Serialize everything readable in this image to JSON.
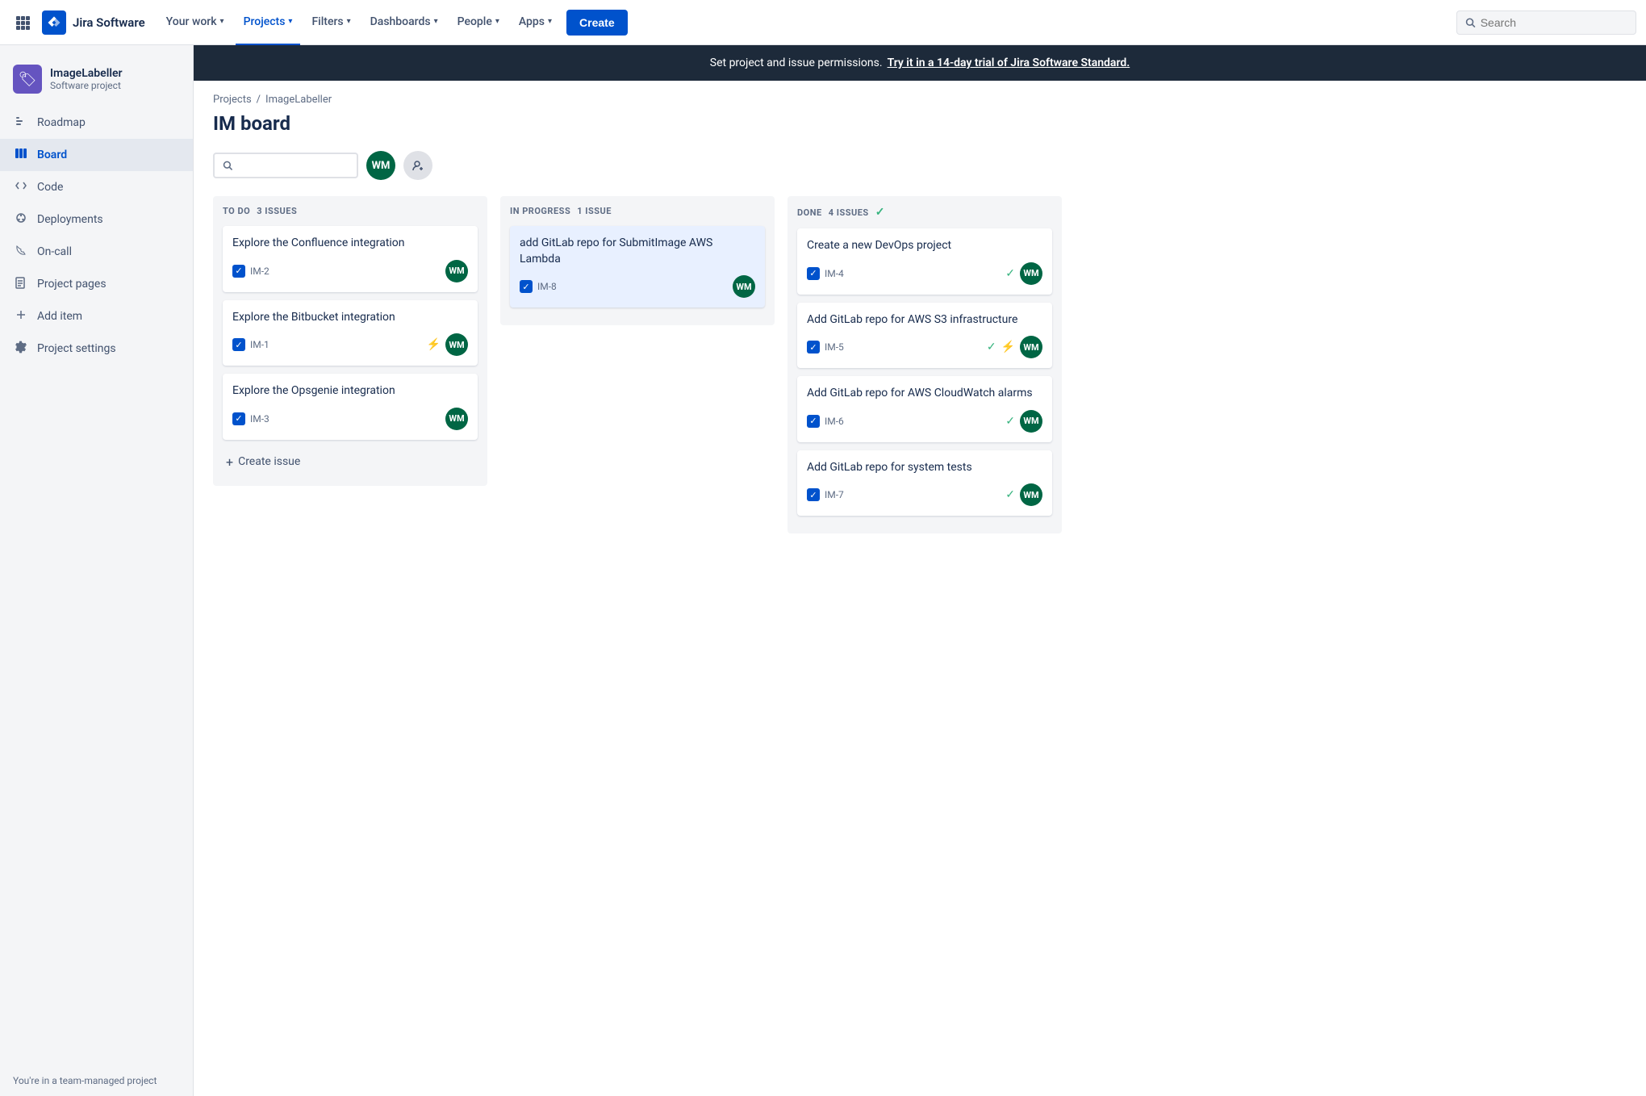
{
  "topnav": {
    "logo_text": "Jira Software",
    "nav_items": [
      {
        "label": "Your work",
        "has_chevron": true,
        "active": false
      },
      {
        "label": "Projects",
        "has_chevron": true,
        "active": true
      },
      {
        "label": "Filters",
        "has_chevron": true,
        "active": false
      },
      {
        "label": "Dashboards",
        "has_chevron": true,
        "active": false
      },
      {
        "label": "People",
        "has_chevron": true,
        "active": false
      },
      {
        "label": "Apps",
        "has_chevron": true,
        "active": false
      }
    ],
    "create_label": "Create",
    "search_placeholder": "Search"
  },
  "banner": {
    "text": "Set project and issue permissions.",
    "link_text": "Try it in a 14-day trial of Jira Software Standard."
  },
  "sidebar": {
    "project_name": "ImageLabeller",
    "project_type": "Software project",
    "nav_items": [
      {
        "label": "Roadmap",
        "icon": "roadmap"
      },
      {
        "label": "Board",
        "icon": "board",
        "active": true
      },
      {
        "label": "Code",
        "icon": "code"
      },
      {
        "label": "Deployments",
        "icon": "deployments"
      },
      {
        "label": "On-call",
        "icon": "oncall"
      },
      {
        "label": "Project pages",
        "icon": "pages"
      },
      {
        "label": "Add item",
        "icon": "add"
      },
      {
        "label": "Project settings",
        "icon": "settings"
      }
    ],
    "footer_text": "You're in a team-managed project"
  },
  "breadcrumb": {
    "parent": "Projects",
    "current": "ImageLabeller"
  },
  "page_title": "IM board",
  "avatar": {
    "initials": "WM",
    "color": "#006644"
  },
  "board": {
    "columns": [
      {
        "id": "todo",
        "label": "TO DO",
        "issue_count": "3 ISSUES",
        "cards": [
          {
            "id": "card-im2",
            "title": "Explore the Confluence integration",
            "issue_id": "IM-2",
            "highlighted": false,
            "show_done_check": false,
            "show_story_icon": false
          },
          {
            "id": "card-im1",
            "title": "Explore the Bitbucket integration",
            "issue_id": "IM-1",
            "highlighted": false,
            "show_done_check": false,
            "show_story_icon": true
          },
          {
            "id": "card-im3",
            "title": "Explore the Opsgenie integration",
            "issue_id": "IM-3",
            "highlighted": false,
            "show_done_check": false,
            "show_story_icon": false
          }
        ],
        "create_issue_label": "Create issue"
      },
      {
        "id": "inprogress",
        "label": "IN PROGRESS",
        "issue_count": "1 ISSUE",
        "cards": [
          {
            "id": "card-im8",
            "title": "add GitLab repo for SubmitImage AWS Lambda",
            "issue_id": "IM-8",
            "highlighted": true,
            "show_done_check": false,
            "show_story_icon": false
          }
        ],
        "create_issue_label": null
      },
      {
        "id": "done",
        "label": "DONE",
        "issue_count": "4 ISSUES",
        "show_check": true,
        "cards": [
          {
            "id": "card-im4",
            "title": "Create a new DevOps project",
            "issue_id": "IM-4",
            "highlighted": false,
            "show_done_check": true,
            "show_story_icon": false
          },
          {
            "id": "card-im5",
            "title": "Add GitLab repo for AWS S3 infrastructure",
            "issue_id": "IM-5",
            "highlighted": false,
            "show_done_check": true,
            "show_story_icon": true
          },
          {
            "id": "card-im6",
            "title": "Add GitLab repo for AWS CloudWatch alarms",
            "issue_id": "IM-6",
            "highlighted": false,
            "show_done_check": true,
            "show_story_icon": false
          },
          {
            "id": "card-im7",
            "title": "Add GitLab repo for system tests",
            "issue_id": "IM-7",
            "highlighted": false,
            "show_done_check": true,
            "show_story_icon": false
          }
        ],
        "create_issue_label": null
      }
    ]
  }
}
